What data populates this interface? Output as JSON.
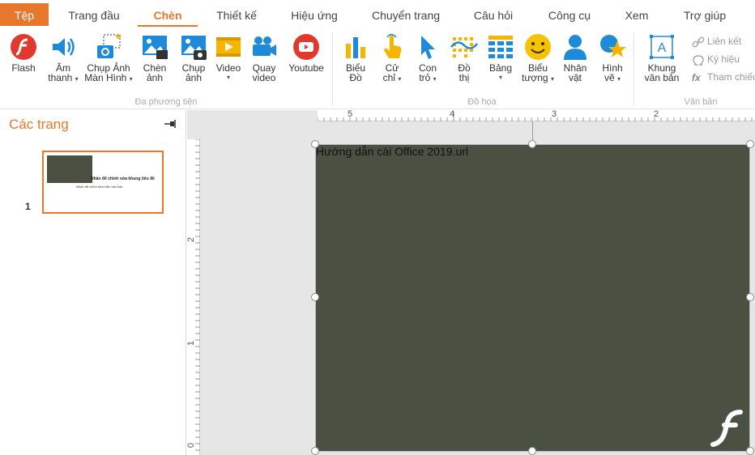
{
  "menu": {
    "tabs": [
      "Tệp",
      "Trang đầu",
      "Chèn",
      "Thiết kế",
      "Hiệu ứng",
      "Chuyển trang",
      "Câu hỏi",
      "Công cụ",
      "Xem",
      "Trợ giúp"
    ],
    "active_tab": "Chèn"
  },
  "ribbon": {
    "media": {
      "group_label": "Đa phương tiện",
      "flash": "Flash",
      "audio_1": "Âm",
      "audio_2": "thanh",
      "screenshot_1": "Chụp Ảnh",
      "screenshot_2": "Màn Hình",
      "insert_image_1": "Chèn",
      "insert_image_2": "ảnh",
      "capture_image_1": "Chụp",
      "capture_image_2": "ảnh",
      "video": "Video",
      "record_video_1": "Quay",
      "record_video_2": "video",
      "youtube": "Youtube"
    },
    "graphics": {
      "group_label": "Đồ họa",
      "chart_1": "Biểu",
      "chart_2": "Đồ",
      "gesture_1": "Cử",
      "gesture_2": "chỉ",
      "pointer_1": "Con",
      "pointer_2": "trỏ",
      "graph_1": "Đồ",
      "graph_2": "thị",
      "table": "Bảng",
      "icon_1": "Biểu",
      "icon_2": "tượng",
      "character_1": "Nhân",
      "character_2": "vật",
      "shape_1": "Hình",
      "shape_2": "vẽ"
    },
    "text": {
      "group_label": "Văn bản",
      "textbox_1": "Khung",
      "textbox_2": "văn bản",
      "link": "Liên kết",
      "symbol": "Ký hiệu",
      "reference": "Tham chiếu"
    }
  },
  "left_panel": {
    "title": "Các trang",
    "slides": [
      {
        "number": "1",
        "thumb_title": "Nhấn để chỉnh sửa khung tiêu đề",
        "thumb_subtitle": "Nhấn để chỉnh sửa kiểu văn bản"
      }
    ]
  },
  "ruler": {
    "horizontal": [
      "5",
      "4",
      "3",
      "2"
    ],
    "vertical": [
      "2",
      "1",
      "0"
    ]
  },
  "slide": {
    "text": "Hướng dẫn cài Office 2019.url",
    "background_color": "#4a5143"
  },
  "colors": {
    "accent": "#e8772e",
    "icon_blue": "#1f8ad8",
    "icon_yellow": "#f7b500",
    "flash_red": "#e03a2f"
  }
}
